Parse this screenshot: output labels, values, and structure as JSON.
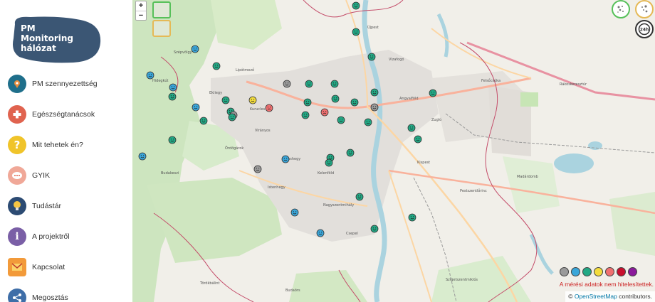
{
  "logo": {
    "line1": "PM",
    "line2": "Monitoring",
    "line3": "hálózat",
    "color": "#3b5674"
  },
  "nav": [
    {
      "label": "PM szennyezettség",
      "icon": "map-pin-icon",
      "color": "#1f6f8b"
    },
    {
      "label": "Egészségtanácsok",
      "icon": "medical-cross-icon",
      "color": "#e0634f"
    },
    {
      "label": "Mit tehetek én?",
      "icon": "question-icon",
      "color": "#f0c42a"
    },
    {
      "label": "GYIK",
      "icon": "chat-bubbles-icon",
      "color": "#f0a898"
    },
    {
      "label": "Tudástár",
      "icon": "lightbulb-icon",
      "color": "#e9b64c"
    },
    {
      "label": "A projektről",
      "icon": "info-icon",
      "color": "#7a5fa6"
    },
    {
      "label": "Kapcsolat",
      "icon": "mail-icon",
      "color": "#f29a3a"
    },
    {
      "label": "Megosztás",
      "icon": "share-icon",
      "color": "#3e6ea8"
    }
  ],
  "map": {
    "zoom_in": "+",
    "zoom_out": "−",
    "top_right": [
      "PM2.5",
      "PM10",
      "24h"
    ],
    "legend": [
      {
        "status": "no-data",
        "color": "#9a9a9a"
      },
      {
        "status": "very-good",
        "color": "#3aa6d9"
      },
      {
        "status": "good",
        "color": "#22a884"
      },
      {
        "status": "moderate",
        "color": "#f3dc3c"
      },
      {
        "status": "bad",
        "color": "#f07070"
      },
      {
        "status": "very-bad",
        "color": "#c8102e"
      },
      {
        "status": "extreme",
        "color": "#8b1a9b"
      }
    ],
    "notice": "A mérési adatok nem hitelesítettek.",
    "attribution": {
      "symbol": "©",
      "link": "OpenStreetMap",
      "suffix": " contributors."
    },
    "places": [
      "Szépvölgy",
      "Hidegkút",
      "Ekliegy",
      "Ördögárok",
      "Kurucles",
      "Lipótmező",
      "Kelenföld",
      "Nagyszentmihály",
      "Sashegy",
      "Istenhegy",
      "Virányos",
      "Budakeszi",
      "Törökbálint",
      "Budaörs",
      "Szigetszentmiklós",
      "Kispest",
      "Rákoskeresztúr",
      "Pestszentlőrinc",
      "Csepel",
      "Újpest",
      "Vizafogó",
      "Felsőcsóka",
      "Angyalföld",
      "Zugló",
      "Madárdomb"
    ]
  }
}
